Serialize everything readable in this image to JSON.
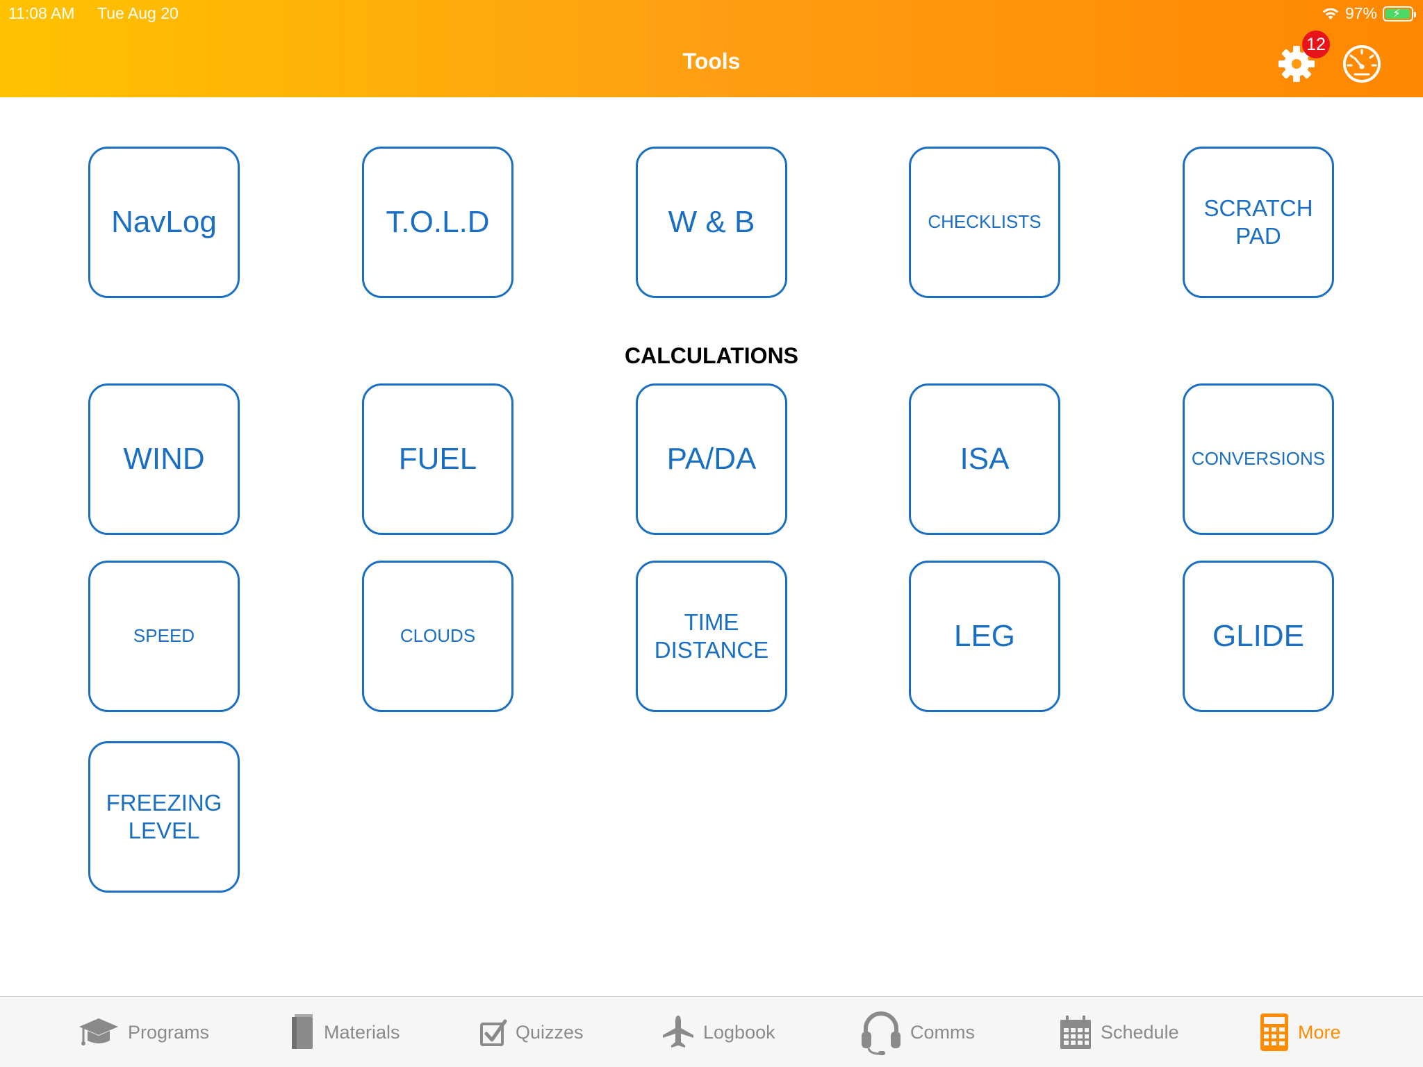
{
  "status_bar": {
    "time": "11:08 AM",
    "date": "Tue Aug 20",
    "battery_percent": "97%",
    "battery_level": 0.97,
    "charging": true
  },
  "header": {
    "title": "Tools",
    "settings_badge": "12",
    "icons": [
      "gear-icon",
      "gauge-icon"
    ],
    "gradient_colors": [
      "#ffc200",
      "#ff8700"
    ]
  },
  "tools": [
    {
      "label": "NavLog"
    },
    {
      "label": "T.O.L.D"
    },
    {
      "label": "W & B"
    },
    {
      "label": "CHECKLISTS"
    },
    {
      "label": "SCRATCH\nPAD"
    }
  ],
  "calculations": {
    "title": "CALCULATIONS",
    "items": [
      {
        "label": "WIND"
      },
      {
        "label": "FUEL"
      },
      {
        "label": "PA/DA"
      },
      {
        "label": "ISA"
      },
      {
        "label": "CONVERSIONS"
      },
      {
        "label": "SPEED"
      },
      {
        "label": "CLOUDS"
      },
      {
        "label": "TIME\nDISTANCE"
      },
      {
        "label": "LEG"
      },
      {
        "label": "GLIDE"
      },
      {
        "label": "FREEZING\nLEVEL"
      }
    ]
  },
  "tabbar": {
    "tabs": [
      {
        "label": "Programs",
        "icon": "graduation-cap-icon",
        "active": false
      },
      {
        "label": "Materials",
        "icon": "book-icon",
        "active": false
      },
      {
        "label": "Quizzes",
        "icon": "checkbox-icon",
        "active": false
      },
      {
        "label": "Logbook",
        "icon": "airplane-icon",
        "active": false
      },
      {
        "label": "Comms",
        "icon": "headset-icon",
        "active": false
      },
      {
        "label": "Schedule",
        "icon": "calendar-icon",
        "active": false
      },
      {
        "label": "More",
        "icon": "calculator-icon",
        "active": true
      }
    ]
  },
  "colors": {
    "tile_border": "#1a6fc2",
    "tile_text": "#1a6fc2",
    "tab_inactive": "#8a8a8a",
    "tab_active": "#ff8c00",
    "badge": "#e8141c"
  }
}
